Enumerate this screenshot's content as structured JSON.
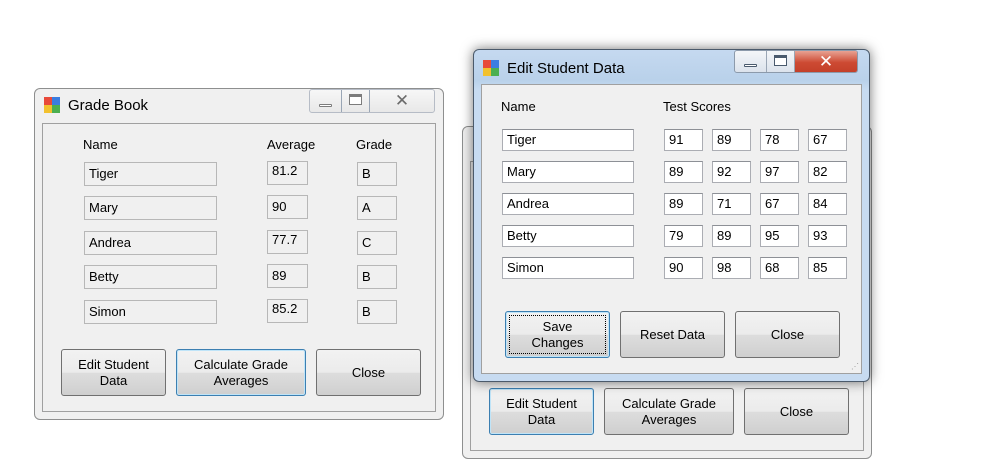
{
  "grade_book": {
    "title": "Grade Book",
    "headers": {
      "name": "Name",
      "average": "Average",
      "grade": "Grade"
    },
    "rows": [
      {
        "name": "Tiger",
        "average": "81.2",
        "grade": "B"
      },
      {
        "name": "Mary",
        "average": "90",
        "grade": "A"
      },
      {
        "name": "Andrea",
        "average": "77.7",
        "grade": "C"
      },
      {
        "name": "Betty",
        "average": "89",
        "grade": "B"
      },
      {
        "name": "Simon",
        "average": "85.2",
        "grade": "B"
      }
    ],
    "buttons": {
      "edit_l1": "Edit Student",
      "edit_l2": "Data",
      "calc_l1": "Calculate Grade",
      "calc_l2": "Averages",
      "close": "Close"
    }
  },
  "background_window": {
    "buttons": {
      "edit_l1": "Edit Student",
      "edit_l2": "Data",
      "calc_l1": "Calculate Grade",
      "calc_l2": "Averages",
      "close": "Close"
    }
  },
  "edit_student": {
    "title": "Edit Student Data",
    "headers": {
      "name": "Name",
      "scores": "Test Scores"
    },
    "rows": [
      {
        "name": "Tiger",
        "scores": [
          "91",
          "89",
          "78",
          "67"
        ]
      },
      {
        "name": "Mary",
        "scores": [
          "89",
          "92",
          "97",
          "82"
        ]
      },
      {
        "name": "Andrea",
        "scores": [
          "89",
          "71",
          "67",
          "84"
        ]
      },
      {
        "name": "Betty",
        "scores": [
          "79",
          "89",
          "95",
          "93"
        ]
      },
      {
        "name": "Simon",
        "scores": [
          "90",
          "98",
          "68",
          "85"
        ]
      }
    ],
    "buttons": {
      "save_l1": "Save",
      "save_l2": "Changes",
      "reset": "Reset Data",
      "close": "Close"
    }
  },
  "colors": {
    "close_button_red": "#c4402a",
    "title_blue": "#b9d1ea",
    "focus_blue": "#3c7fb1"
  }
}
